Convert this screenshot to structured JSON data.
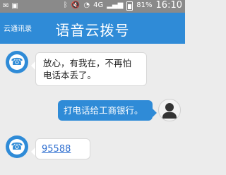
{
  "status_bar": {
    "left_icons": [
      "notification-icon",
      "image-icon"
    ],
    "right_icons": [
      "bluetooth-icon",
      "mute-icon",
      "wifi-icon",
      "signal-icon",
      "battery-icon"
    ],
    "network": "4G",
    "battery": "81%",
    "time": "16:10"
  },
  "header": {
    "app_name": "云通讯录",
    "title": "语音云拨号"
  },
  "messages": [
    {
      "side": "incoming",
      "text_line1": "放心，有我在，不再怕",
      "text_line2": "电话本丢了。"
    },
    {
      "side": "outgoing",
      "text": "打电话给工商银行。"
    },
    {
      "side": "incoming",
      "text": "95588",
      "is_link": true
    }
  ],
  "colors": {
    "header_blue": "#2f8bd7",
    "background": "#ececec"
  }
}
